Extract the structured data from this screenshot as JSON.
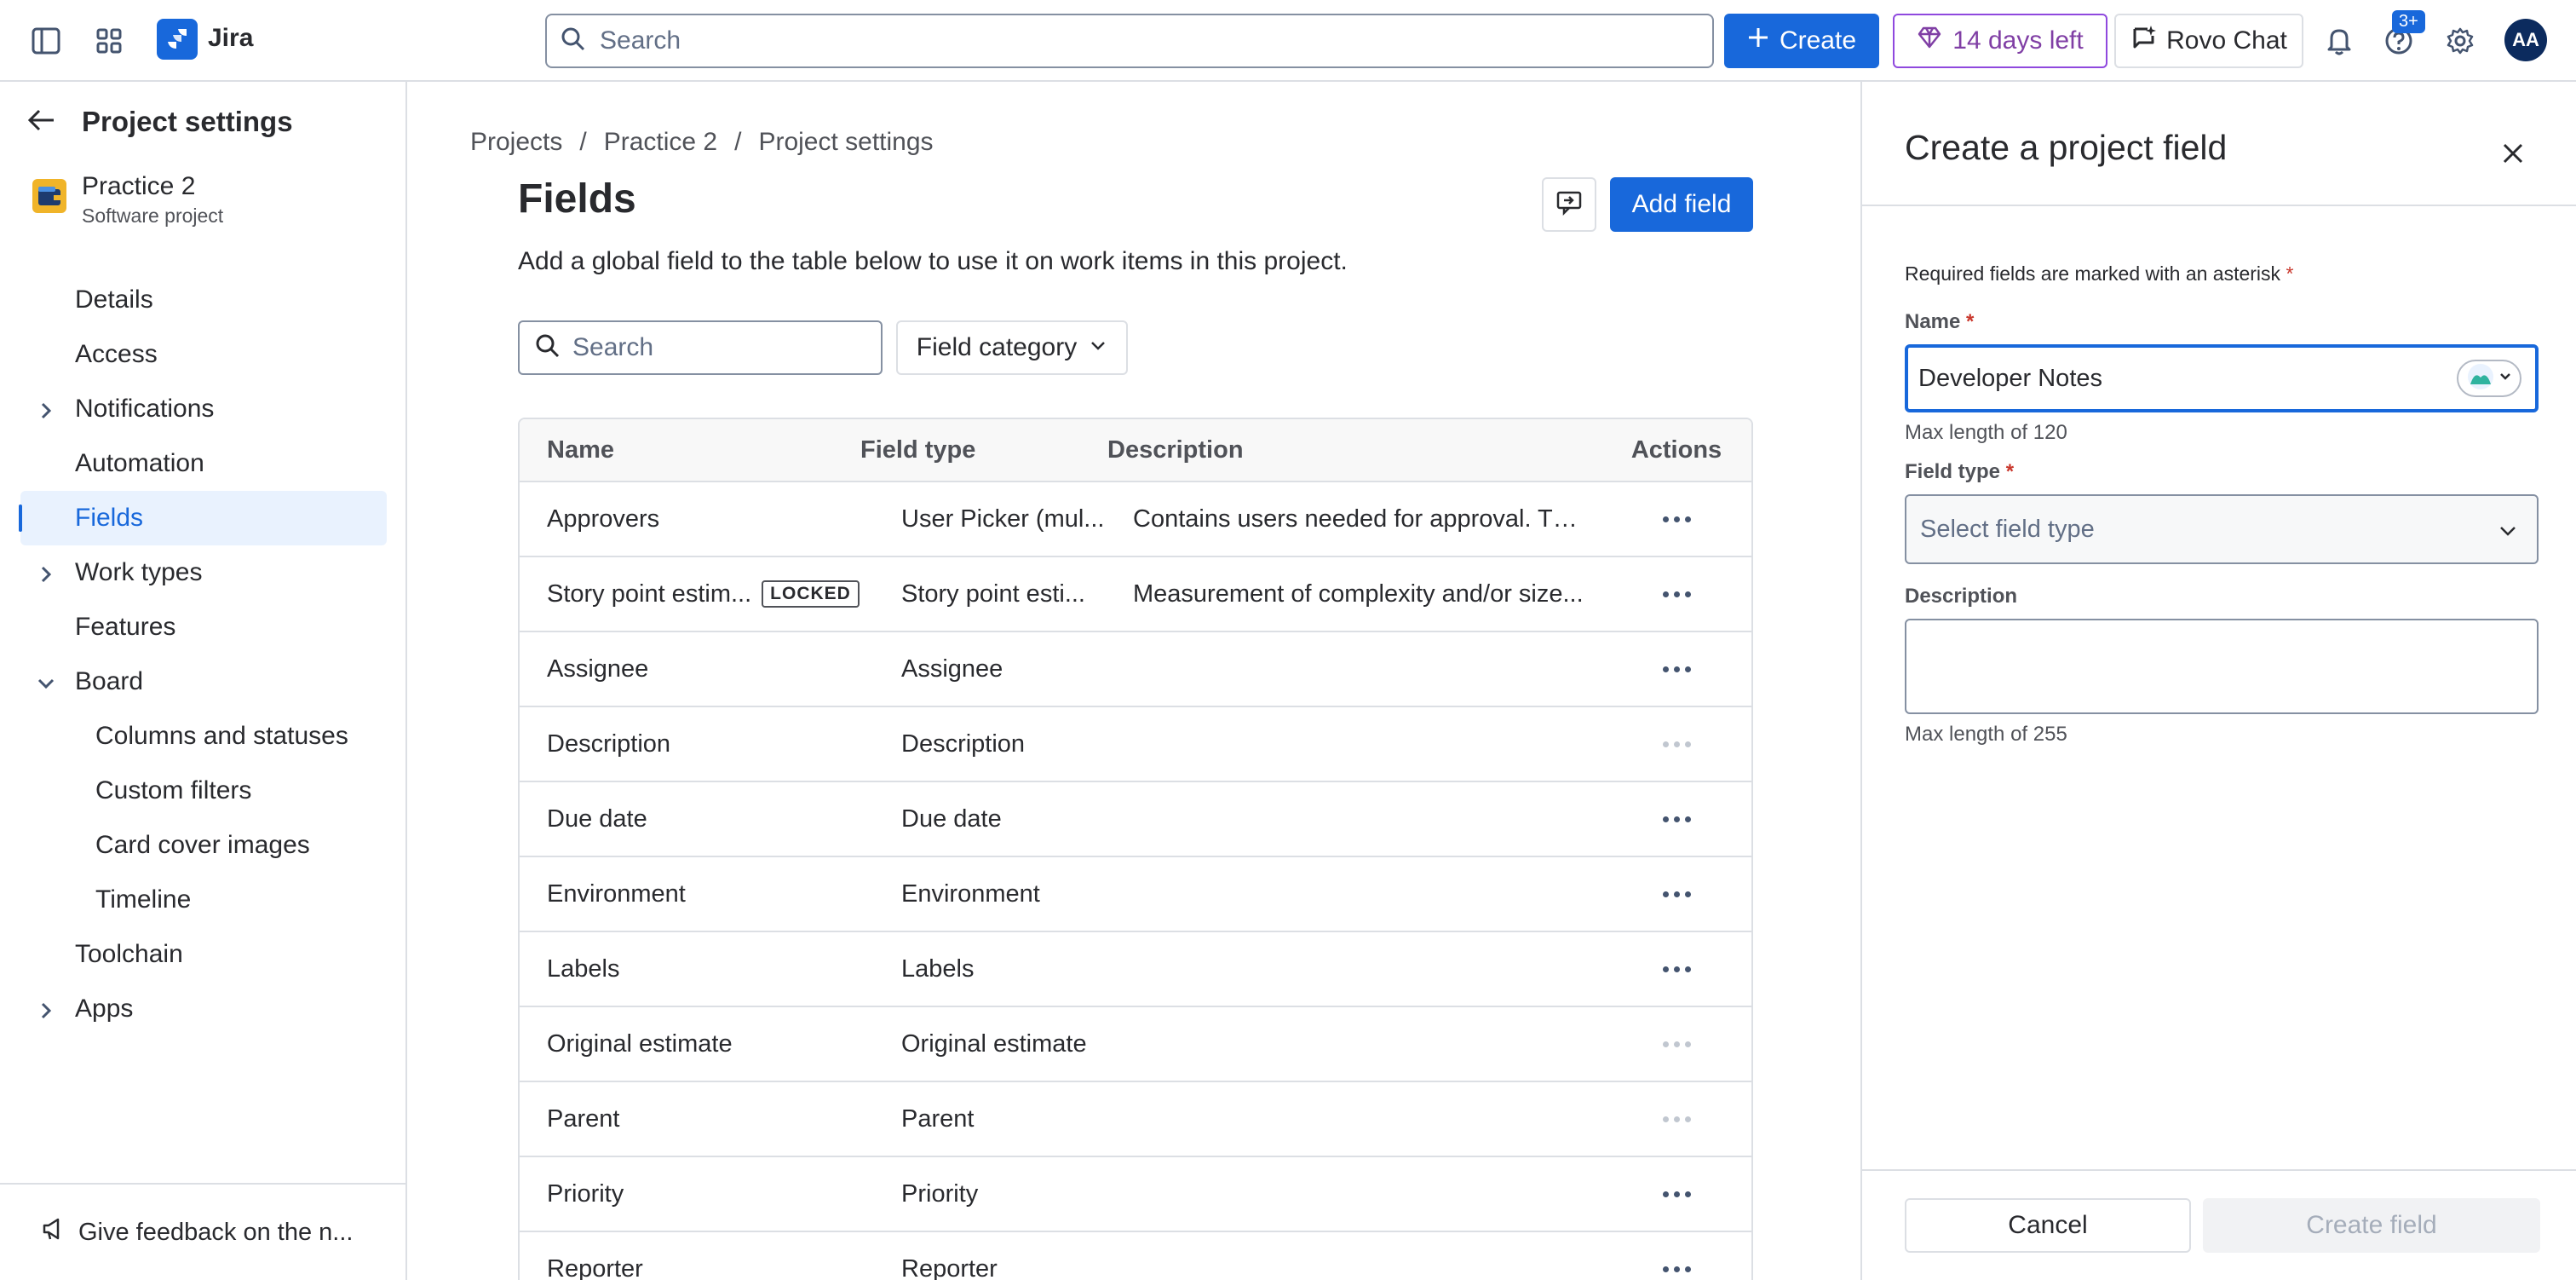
{
  "topbar": {
    "app_name": "Jira",
    "search_placeholder": "Search",
    "create_label": "Create",
    "trial_label": "14 days left",
    "rovo_label": "Rovo Chat",
    "help_badge": "3+",
    "avatar_initials": "AA"
  },
  "sidebar": {
    "title": "Project settings",
    "project_name": "Practice 2",
    "project_type": "Software project",
    "items": [
      {
        "label": "Details"
      },
      {
        "label": "Access"
      },
      {
        "label": "Notifications"
      },
      {
        "label": "Automation"
      },
      {
        "label": "Fields"
      },
      {
        "label": "Work types"
      },
      {
        "label": "Features"
      },
      {
        "label": "Board"
      },
      {
        "label": "Columns and statuses"
      },
      {
        "label": "Custom filters"
      },
      {
        "label": "Card cover images"
      },
      {
        "label": "Timeline"
      },
      {
        "label": "Toolchain"
      },
      {
        "label": "Apps"
      }
    ],
    "feedback_label": "Give feedback on the n..."
  },
  "main": {
    "breadcrumb": [
      "Projects",
      "Practice 2",
      "Project settings"
    ],
    "title": "Fields",
    "add_field_label": "Add field",
    "description": "Add a global field to the table below to use it on work items in this project.",
    "search_placeholder": "Search",
    "category_label": "Field category",
    "columns": [
      "Name",
      "Field type",
      "Description",
      "Actions"
    ],
    "rows": [
      {
        "name": "Approvers",
        "type": "User Picker (mul...",
        "desc": "Contains users needed for approval. Th..."
      },
      {
        "name": "Story point estim...",
        "type": "Story point esti...",
        "desc": "Measurement of complexity and/or size...",
        "badge": "LOCKED"
      },
      {
        "name": "Assignee",
        "type": "Assignee",
        "desc": ""
      },
      {
        "name": "Description",
        "type": "Description",
        "desc": ""
      },
      {
        "name": "Due date",
        "type": "Due date",
        "desc": ""
      },
      {
        "name": "Environment",
        "type": "Environment",
        "desc": ""
      },
      {
        "name": "Labels",
        "type": "Labels",
        "desc": ""
      },
      {
        "name": "Original estimate",
        "type": "Original estimate",
        "desc": ""
      },
      {
        "name": "Parent",
        "type": "Parent",
        "desc": ""
      },
      {
        "name": "Priority",
        "type": "Priority",
        "desc": ""
      },
      {
        "name": "Reporter",
        "type": "Reporter",
        "desc": ""
      }
    ]
  },
  "panel": {
    "title": "Create a project field",
    "required_note": "Required fields are marked with an asterisk",
    "name_label": "Name",
    "name_value": "Developer Notes",
    "name_hint": "Max length of 120",
    "type_label": "Field type",
    "type_placeholder": "Select field type",
    "desc_label": "Description",
    "desc_hint": "Max length of 255",
    "cancel_label": "Cancel",
    "create_label": "Create field"
  },
  "colors": {
    "accent": "#1868db",
    "trial": "#803fa5",
    "required": "#c9372c"
  }
}
